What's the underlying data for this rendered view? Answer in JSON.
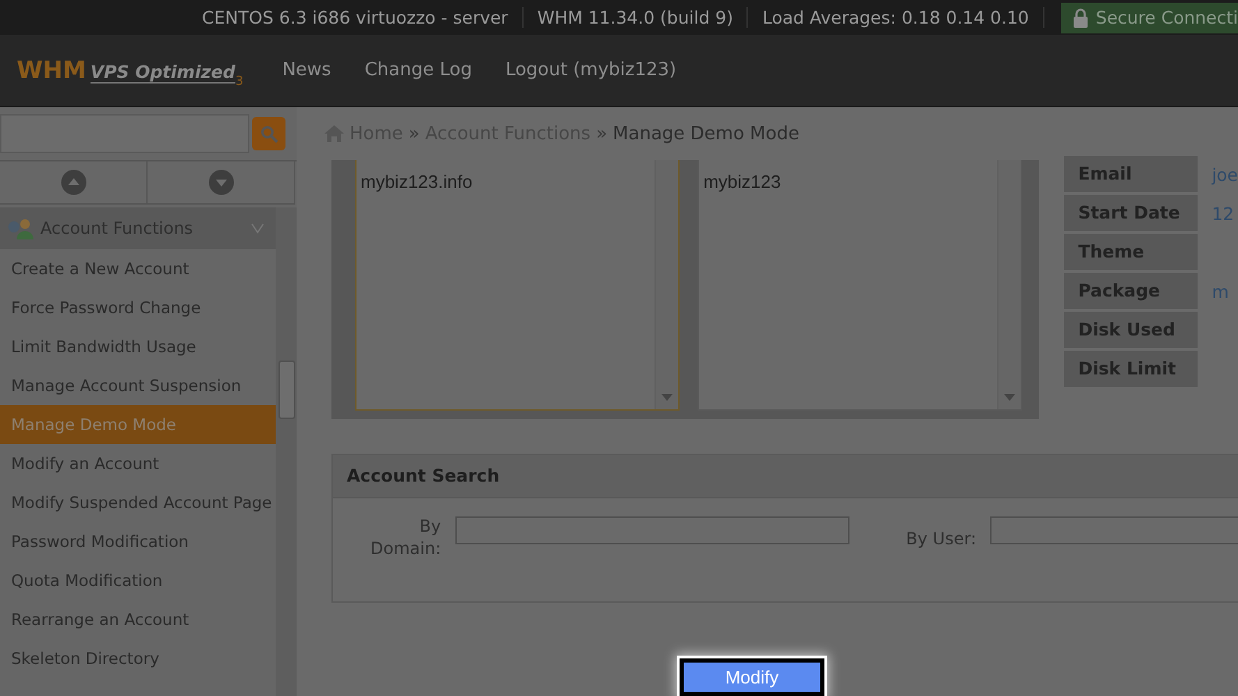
{
  "status_bar": {
    "items": [
      "CENTOS 6.3 i686 virtuozzo - server",
      "WHM 11.34.0 (build 9)",
      "Load Averages: 0.18 0.14 0.10"
    ],
    "secure": "Secure Connecti"
  },
  "nav": {
    "logo_main": "WHM",
    "logo_sub": "VPS Optimized",
    "logo_mark": "3",
    "links": [
      "News",
      "Change Log",
      "Logout (mybiz123)"
    ]
  },
  "breadcrumb": {
    "separator": "»",
    "items": [
      "Home",
      "Account Functions",
      "Manage Demo Mode"
    ]
  },
  "sidebar": {
    "section": "Account Functions",
    "items": [
      {
        "label": "Create a New Account",
        "selected": false
      },
      {
        "label": "Force Password Change",
        "selected": false
      },
      {
        "label": "Limit Bandwidth Usage",
        "selected": false
      },
      {
        "label": "Manage Account Suspension",
        "selected": false
      },
      {
        "label": "Manage Demo Mode",
        "selected": true
      },
      {
        "label": "Modify an Account",
        "selected": false
      },
      {
        "label": "Modify Suspended Account Page",
        "selected": false
      },
      {
        "label": "Password Modification",
        "selected": false
      },
      {
        "label": "Quota Modification",
        "selected": false
      },
      {
        "label": "Rearrange an Account",
        "selected": false
      },
      {
        "label": "Skeleton Directory",
        "selected": false
      }
    ]
  },
  "domain_list": [
    "mybiz123.info"
  ],
  "user_list": [
    "mybiz123"
  ],
  "account_info": [
    {
      "label": "Email",
      "value": "joe"
    },
    {
      "label": "Start Date",
      "value": "12"
    },
    {
      "label": "Theme"
    },
    {
      "label": "Package",
      "value": "m"
    },
    {
      "label": "Disk Used"
    },
    {
      "label": "Disk Limit"
    }
  ],
  "account_search": {
    "title": "Account Search",
    "domain_label": "By Domain:",
    "user_label": "By User:"
  },
  "button": "Modify"
}
